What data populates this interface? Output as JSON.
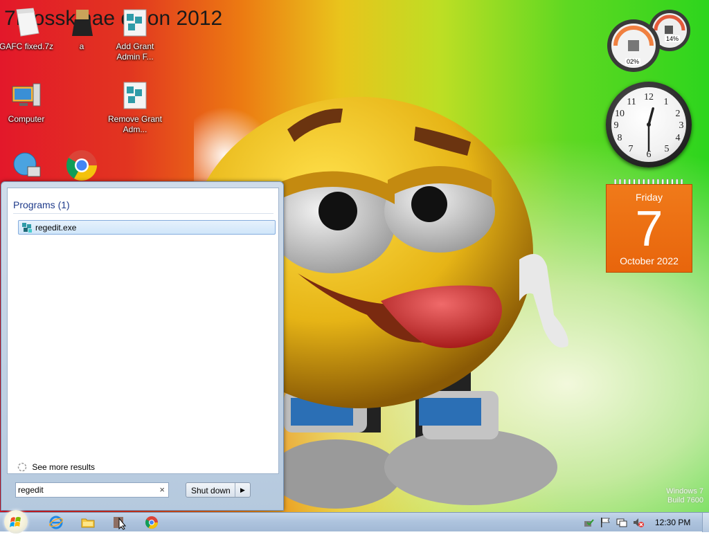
{
  "wallpaper": {
    "title": "7Mosskinae dition 2012"
  },
  "desktop_icons": [
    {
      "label": "GAFC fixed.7z"
    },
    {
      "label": "a"
    },
    {
      "label": "Add Grant Admin F..."
    },
    {
      "label": "Computer"
    },
    {
      "label": "Remove Grant Adm..."
    },
    {
      "label": ""
    },
    {
      "label": ""
    }
  ],
  "gadgets": {
    "cpu_meter": {
      "cpu": "02%",
      "memory": "14%"
    },
    "clock": {
      "hour": 12,
      "minute": 30
    },
    "calendar": {
      "day_of_week": "Friday",
      "day": "7",
      "month_year": "October 2022"
    }
  },
  "start_menu": {
    "section_header": "Programs (1)",
    "results": [
      {
        "label": "regedit.exe",
        "icon": "registry-editor-icon"
      }
    ],
    "see_more": "See more results",
    "search": {
      "value": "regedit",
      "clear_symbol": "×"
    },
    "shutdown_label": "Shut down",
    "shutdown_arrow": "▶"
  },
  "watermark": {
    "line1": "Windows 7",
    "line2": "Build 7600"
  },
  "taskbar": {
    "pinned": [
      "internet-explorer-icon",
      "folder-icon",
      "cursor-app-icon",
      "chrome-icon"
    ],
    "tray": [
      "action-center-icon",
      "flag-icon",
      "network-icon",
      "volume-muted-icon"
    ],
    "time": "12:30 PM"
  },
  "colors": {
    "accent": "#1e3a8a",
    "calendar": "#e8650c",
    "taskbar": "#aec4de"
  }
}
